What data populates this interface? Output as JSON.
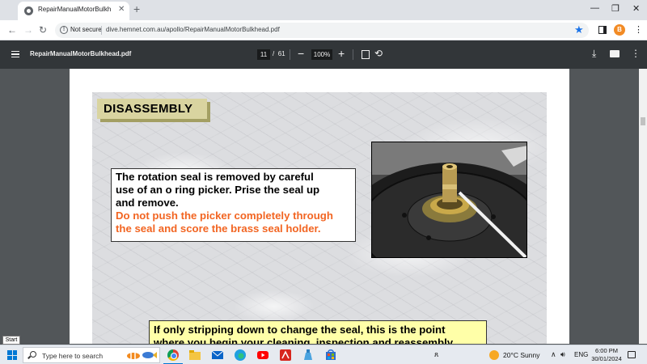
{
  "browser": {
    "tab_title": "RepairManualMotorBulkhead.pdf",
    "new_tab": "+",
    "tab_close": "✕",
    "not_secure": "Not secure",
    "url": "dive.hemnet.com.au/apollo/RepairManualMotorBulkhead.pdf",
    "profile_initial": "B"
  },
  "pdf_toolbar": {
    "file_name": "RepairManualMotorBulkhead.pdf",
    "current_page": "11",
    "page_separator": "/",
    "total_pages": "61",
    "zoom": "100%"
  },
  "slide": {
    "heading": "DISASSEMBLY",
    "instruction_lines": [
      "The rotation seal is removed by  careful",
      "use of an o ring picker. Prise the seal up",
      "and remove."
    ],
    "warning_lines": [
      "Do not push the picker completely through",
      "the seal and score the brass seal holder."
    ],
    "note_lines": [
      "If only stripping down to change the seal, this is the point",
      "where you begin your cleaning, inspection and reassembly."
    ],
    "colors": {
      "heading_bg": "#d9d4a0",
      "warning": "#f26522",
      "note_bg": "#ffffa8"
    }
  },
  "start_tooltip": "Start",
  "taskbar": {
    "search_placeholder": "Type here to search",
    "weather": "20°C  Sunny",
    "language": "ENG",
    "time": "6:00 PM",
    "date": "30/01/2024",
    "apps": [
      "chrome-icon",
      "file-explorer-icon",
      "mail-icon",
      "edge-icon",
      "youtube-icon",
      "acrobat-icon",
      "cleaner-icon",
      "store-icon"
    ]
  }
}
